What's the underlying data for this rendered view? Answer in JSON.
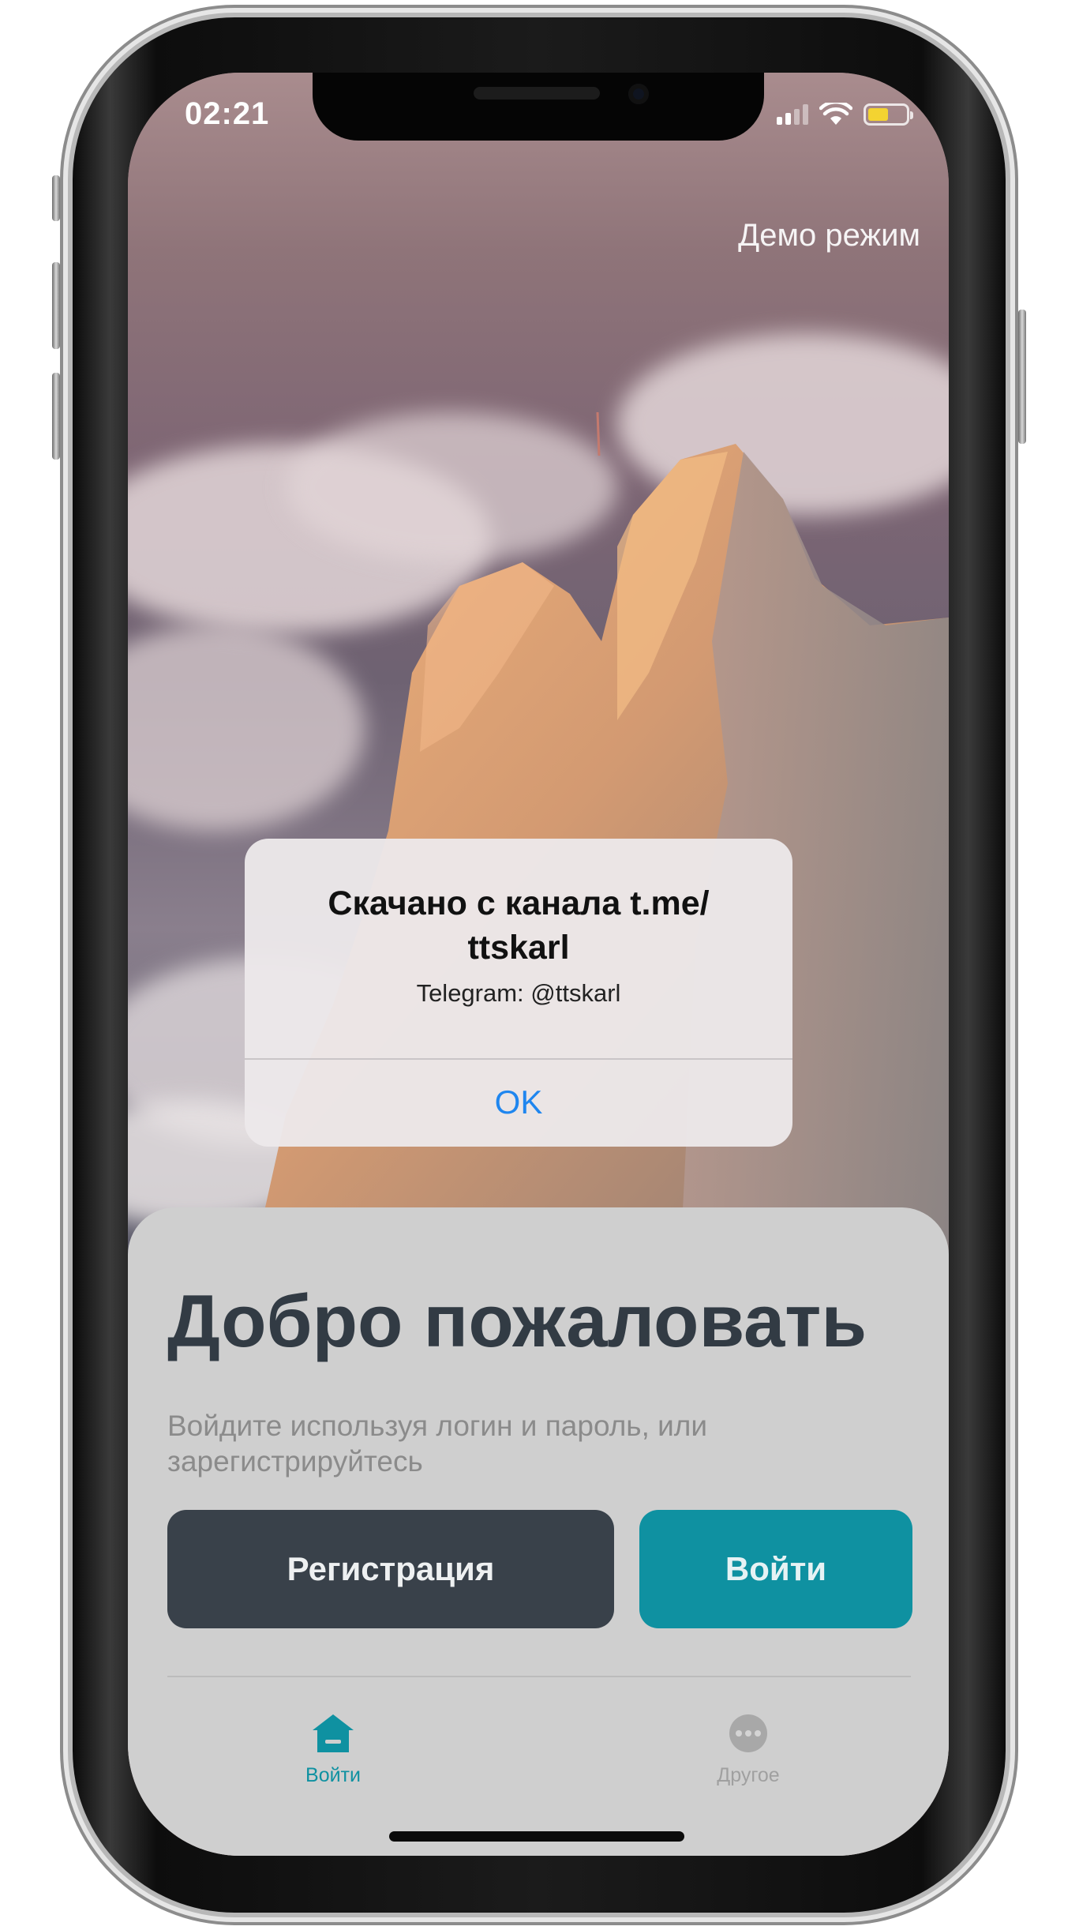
{
  "status_bar": {
    "time": "02:21",
    "battery_level": 0.5,
    "battery_color": "#f3d331"
  },
  "header": {
    "demo_mode": "Демо режим"
  },
  "alert": {
    "title": "Скачано с канала t.me/ ttskarl",
    "message": "Telegram: @ttskarl",
    "ok_label": "OK",
    "ok_color": "#1f86ef"
  },
  "sheet": {
    "title": "Добро пожаловать",
    "subtitle": "Войдите используя логин и пароль, или зарегистрируйтесь",
    "register_label": "Регистрация",
    "login_label": "Войти",
    "accent_color": "#0f91a1",
    "dark_button_color": "#39414a"
  },
  "tabbar": {
    "tabs": [
      {
        "label": "Войти",
        "icon": "home-icon",
        "active": true
      },
      {
        "label": "Другое",
        "icon": "more-icon",
        "active": false
      }
    ]
  }
}
